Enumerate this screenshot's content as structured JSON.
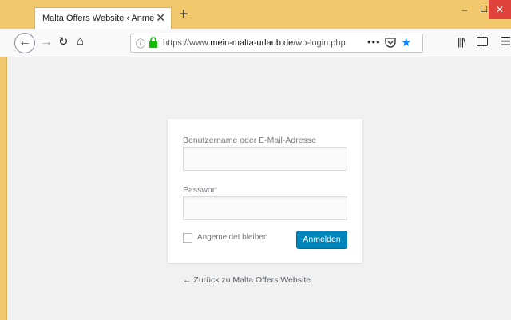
{
  "browser": {
    "tab_title": "Malta Offers Website ‹ Anmelden",
    "tab_close": "✕",
    "new_tab": "+",
    "url_scheme": "https://www.",
    "url_domain": "mein-malta-urlaub.de",
    "url_path": "/wp-login.php",
    "page_actions": "•••",
    "window_min": "–",
    "window_max": "☐",
    "window_close": "✕",
    "icons": [
      "back-icon",
      "forward-icon",
      "reload-icon",
      "home-icon",
      "info-icon",
      "lock-icon",
      "pocket-icon",
      "star-icon",
      "library-icon",
      "sidebar-icon",
      "menu-icon"
    ],
    "lock_color": "#12bc00",
    "star_color": "#0a84ff"
  },
  "login": {
    "username_label": "Benutzername oder E-Mail-Adresse",
    "username_value": "",
    "password_label": "Passwort",
    "password_value": "",
    "remember_label": "Angemeldet bleiben",
    "submit_label": "Anmelden",
    "submit_color": "#0085ba"
  },
  "back_link": "← Zurück zu Malta Offers Website"
}
